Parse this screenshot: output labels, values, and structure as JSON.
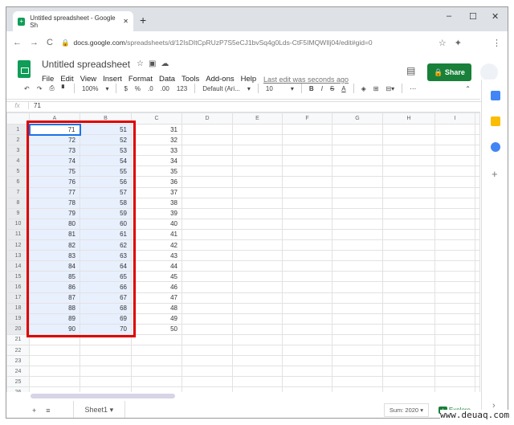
{
  "browser": {
    "tab_title": "Untitled spreadsheet - Google Sh",
    "url_host": "docs.google.com",
    "url_path": "/spreadsheets/d/12IsDItCpRUzP7S5eCJ1bvSq4g0Lds-CtF5IMQWIlj04/edit#gid=0"
  },
  "app": {
    "title": "Untitled spreadsheet",
    "menu": [
      "File",
      "Edit",
      "View",
      "Insert",
      "Format",
      "Data",
      "Tools",
      "Add-ons",
      "Help"
    ],
    "last_edit": "Last edit was seconds ago",
    "share": "Share"
  },
  "toolbar": {
    "zoom": "100%",
    "currency": "$",
    "percent": "%",
    "dec_less": ".0",
    "dec_more": ".00",
    "format": "123",
    "font": "Default (Ari...",
    "font_size": "10",
    "bold": "B",
    "italic": "I",
    "strike": "S",
    "text_color": "A"
  },
  "formula": {
    "fx": "fx",
    "value": "71"
  },
  "columns": [
    "A",
    "B",
    "C",
    "D",
    "E",
    "F",
    "G",
    "H",
    "I"
  ],
  "rows": [
    [
      "71",
      "51",
      "31"
    ],
    [
      "72",
      "52",
      "32"
    ],
    [
      "73",
      "53",
      "33"
    ],
    [
      "74",
      "54",
      "34"
    ],
    [
      "75",
      "55",
      "35"
    ],
    [
      "76",
      "56",
      "36"
    ],
    [
      "77",
      "57",
      "37"
    ],
    [
      "78",
      "58",
      "38"
    ],
    [
      "79",
      "59",
      "39"
    ],
    [
      "80",
      "60",
      "40"
    ],
    [
      "81",
      "61",
      "41"
    ],
    [
      "82",
      "62",
      "42"
    ],
    [
      "83",
      "63",
      "43"
    ],
    [
      "84",
      "64",
      "44"
    ],
    [
      "85",
      "65",
      "45"
    ],
    [
      "86",
      "66",
      "46"
    ],
    [
      "87",
      "67",
      "47"
    ],
    [
      "88",
      "68",
      "48"
    ],
    [
      "89",
      "69",
      "49"
    ],
    [
      "90",
      "70",
      "50"
    ],
    [],
    [],
    [],
    [],
    [],
    []
  ],
  "bottom": {
    "sheet": "Sheet1",
    "sum": "Sum: 2020",
    "explore": "Explore"
  },
  "watermark": "www.deuaq.com",
  "colors": {
    "accent": "#188038",
    "highlight": "#dd0000"
  }
}
